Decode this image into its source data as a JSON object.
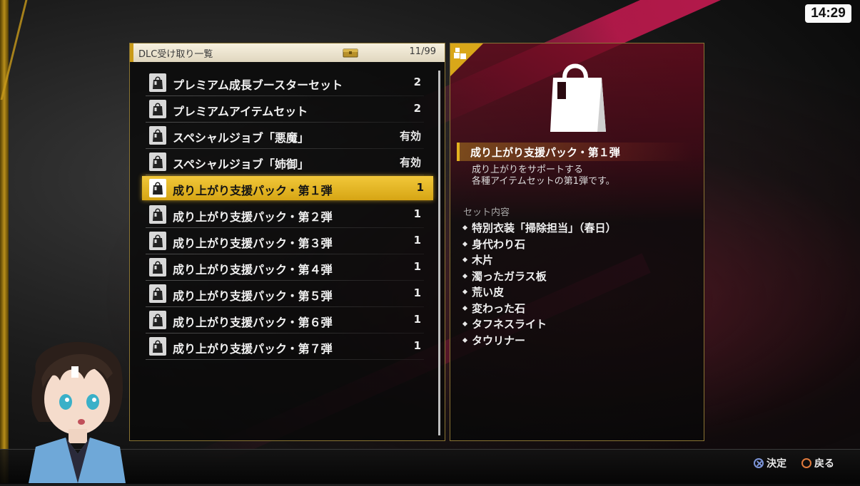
{
  "clock": "14:29",
  "list": {
    "title": "DLC受け取り一覧",
    "count": "11/99",
    "items": [
      {
        "name": "プレミアム成長ブースターセット",
        "qty": "2"
      },
      {
        "name": "プレミアムアイテムセット",
        "qty": "2"
      },
      {
        "name": "スペシャルジョブ「悪魔」",
        "qty": "有効"
      },
      {
        "name": "スペシャルジョブ「姉御」",
        "qty": "有効"
      },
      {
        "name": "成り上がり支援パック・第１弾",
        "qty": "1",
        "selected": true
      },
      {
        "name": "成り上がり支援パック・第２弾",
        "qty": "1"
      },
      {
        "name": "成り上がり支援パック・第３弾",
        "qty": "1"
      },
      {
        "name": "成り上がり支援パック・第４弾",
        "qty": "1"
      },
      {
        "name": "成り上がり支援パック・第５弾",
        "qty": "1"
      },
      {
        "name": "成り上がり支援パック・第６弾",
        "qty": "1"
      },
      {
        "name": "成り上がり支援パック・第７弾",
        "qty": "1"
      }
    ]
  },
  "detail": {
    "title": "成り上がり支援パック・第１弾",
    "desc_line1": "成り上がりをサポートする",
    "desc_line2": "各種アイテムセットの第1弾です。",
    "set_label": "セット内容",
    "contents": [
      "特別衣装「掃除担当」（春日）",
      "身代わり石",
      "木片",
      "濁ったガラス板",
      "荒い皮",
      "変わった石",
      "タフネスライト",
      "タウリナー"
    ]
  },
  "hints": {
    "confirm": "決定",
    "back": "戻る"
  },
  "colors": {
    "accent_gold": "#d6a514",
    "stripe_red": "#c81950"
  }
}
